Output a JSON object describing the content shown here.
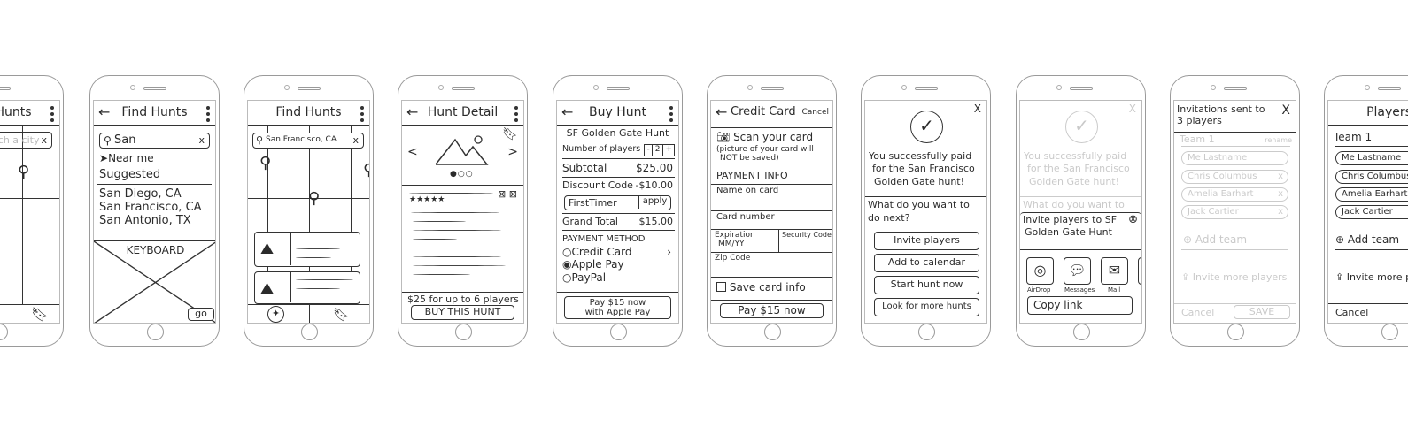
{
  "find_hunts_map_partial": {
    "title": "Find Hunts",
    "search_placeholder": "Search a city",
    "clear": "x"
  },
  "find_hunts_search": {
    "title": "Find Hunts",
    "search_value": "San",
    "clear": "x",
    "near_me": "Near me",
    "suggested": "Suggested",
    "results": [
      "San Diego, CA",
      "San Francisco, CA",
      "San Antonio, TX"
    ],
    "keyboard": "KEYBOARD",
    "go": "go"
  },
  "find_hunts_map": {
    "title": "Find Hunts",
    "search_value": "San Francisco, CA",
    "clear": "x"
  },
  "hunt_detail": {
    "title": "Hunt Detail",
    "stars": "★★★★★",
    "price_text": "$25 for up to 6 players",
    "buy_button": "BUY THIS HUNT",
    "prev": "<",
    "next": ">"
  },
  "buy_hunt": {
    "title": "Buy Hunt",
    "hunt_name": "SF Golden Gate Hunt",
    "players_label": "Number of players",
    "players_minus": "-",
    "players_value": "2",
    "players_plus": "+",
    "subtotal_label": "Subtotal",
    "subtotal_value": "$25.00",
    "discount_label": "Discount Code",
    "discount_value": "-$10.00",
    "code_value": "FirstTimer",
    "apply": "apply",
    "grand_total_label": "Grand Total",
    "grand_total_value": "$15.00",
    "payment_method": "PAYMENT METHOD",
    "options": [
      "Credit Card",
      "Apple Pay",
      "PayPal"
    ],
    "selected_option": "Apple Pay",
    "pay_button_line1": "Pay $15 now",
    "pay_button_line2": "with Apple Pay"
  },
  "credit_card": {
    "title": "Credit Card",
    "cancel": "Cancel",
    "scan": "Scan your card",
    "scan_note_1": "(picture of your card will",
    "scan_note_2": "NOT be saved)",
    "payment_info": "PAYMENT INFO",
    "name": "Name on card",
    "number": "Card number",
    "expiration": "Expiration",
    "expiration_placeholder": "MM/YY",
    "security": "Security Code",
    "zip": "Zip Code",
    "save": "Save card info",
    "pay_button": "Pay $15 now"
  },
  "success": {
    "close": "X",
    "msg1": "You successfully paid",
    "msg2": "for the San Francisco",
    "msg3": "Golden Gate hunt!",
    "question1": "What do you want to",
    "question2": "do next?",
    "buttons": [
      "Invite players",
      "Add to calendar",
      "Start hunt now",
      "Look for more hunts"
    ]
  },
  "share": {
    "title1": "Invite players to SF",
    "title2": "Golden Gate Hunt",
    "targets": [
      "AirDrop",
      "Messages",
      "Mail"
    ],
    "copy_link": "Copy link"
  },
  "invitations": {
    "title1": "Invitations sent to",
    "title2": "3 players",
    "close": "X",
    "team": "Team 1",
    "rename": "rename",
    "members": [
      "Me Lastname",
      "Chris Columbus",
      "Amelia Earhart",
      "Jack Cartier"
    ],
    "add_team": "Add team",
    "invite_more": "Invite more players",
    "cancel": "Cancel",
    "save": "SAVE"
  },
  "players": {
    "title": "Players",
    "team": "Team 1",
    "members": [
      "Me Lastname",
      "Chris Columbus",
      "Amelia Earhart",
      "Jack Cartier"
    ],
    "add_team": "Add team",
    "invite_more": "Invite more players",
    "cancel": "Cancel"
  }
}
